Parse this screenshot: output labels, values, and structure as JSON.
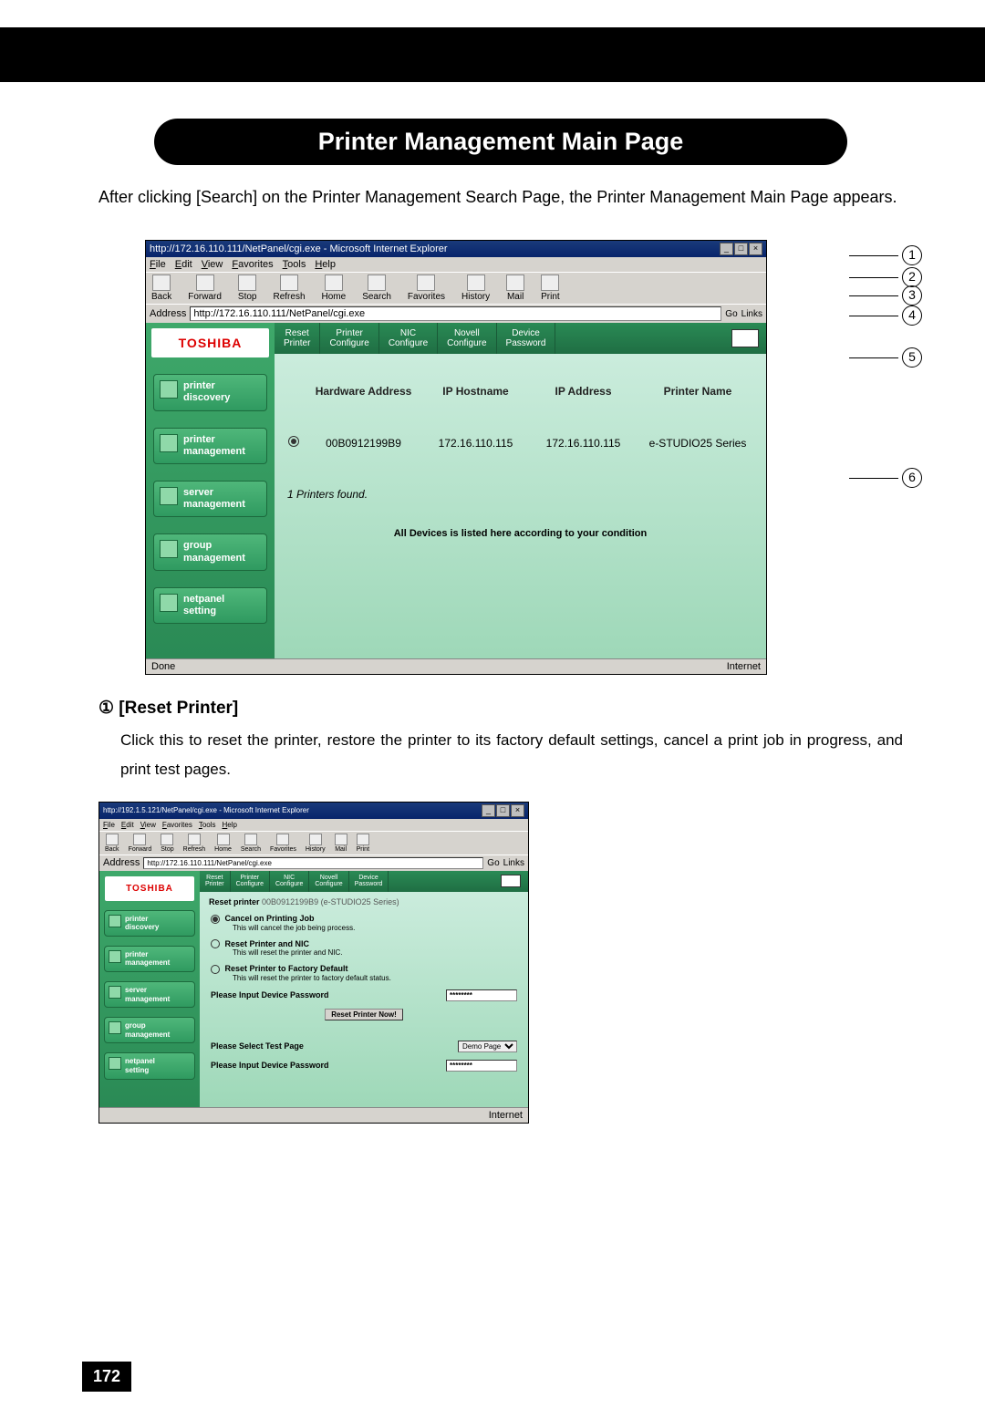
{
  "page_number": "172",
  "header_title": "Printer Management Main Page",
  "intro": "After clicking [Search] on the Printer Management Search Page, the Printer Management Main Page appears.",
  "callout_nums": [
    "1",
    "2",
    "3",
    "4",
    "5",
    "6"
  ],
  "ie_main": {
    "title": "http://172.16.110.111/NetPanel/cgi.exe - Microsoft Internet Explorer",
    "menu": [
      "File",
      "Edit",
      "View",
      "Favorites",
      "Tools",
      "Help"
    ],
    "toolbar": [
      "Back",
      "Forward",
      "Stop",
      "Refresh",
      "Home",
      "Search",
      "Favorites",
      "History",
      "Mail",
      "Print"
    ],
    "address_label": "Address",
    "address_url": "http://172.16.110.111/NetPanel/cgi.exe",
    "go": "Go",
    "links": "Links",
    "status_left": "Done",
    "status_right": "Internet"
  },
  "brand": "TOSHIBA",
  "sidebar_items": [
    "printer\ndiscovery",
    "printer\nmanagement",
    "server\nmanagement",
    "group\nmanagement",
    "netpanel\nsetting"
  ],
  "top_tabs": [
    "Reset\nPrinter",
    "Printer\nConfigure",
    "NIC\nConfigure",
    "Novell\nConfigure",
    "Device\nPassword"
  ],
  "columns": [
    "Hardware Address",
    "IP Hostname",
    "IP Address",
    "Printer Name"
  ],
  "row": {
    "hw": "00B0912199B9",
    "host": "172.16.110.115",
    "ip": "172.16.110.115",
    "name": "e-STUDIO25 Series"
  },
  "found": "1 Printers found.",
  "notice": "All Devices is listed here according to your condition",
  "section1": {
    "heading": "① [Reset Printer]",
    "body": "Click this to reset the printer, restore the printer to its factory default settings, cancel a print job in progress, and print test pages."
  },
  "ie_small": {
    "title": "http://192.1.5.121/NetPanel/cgi.exe - Microsoft Internet Explorer",
    "address_url": "http://172.16.110.111/NetPanel/cgi.exe",
    "reset_header": "Reset printer",
    "reset_sub": "00B0912199B9 (e-STUDIO25 Series)",
    "opt1": "Cancel on Printing Job",
    "opt1_desc": "This will cancel the job being process.",
    "opt2": "Reset Printer and NIC",
    "opt2_desc": "This will reset the printer and NIC.",
    "opt3": "Reset Printer to Factory Default",
    "opt3_desc": "This will reset the printer to factory default status.",
    "pw_label": "Please Input Device Password",
    "pw_mask": "********",
    "btn": "Reset Printer Now!",
    "test_label": "Please Select Test Page",
    "test_opt": "Demo Page",
    "pw_label2": "Please Input Device Password",
    "pw_mask2": "********"
  }
}
